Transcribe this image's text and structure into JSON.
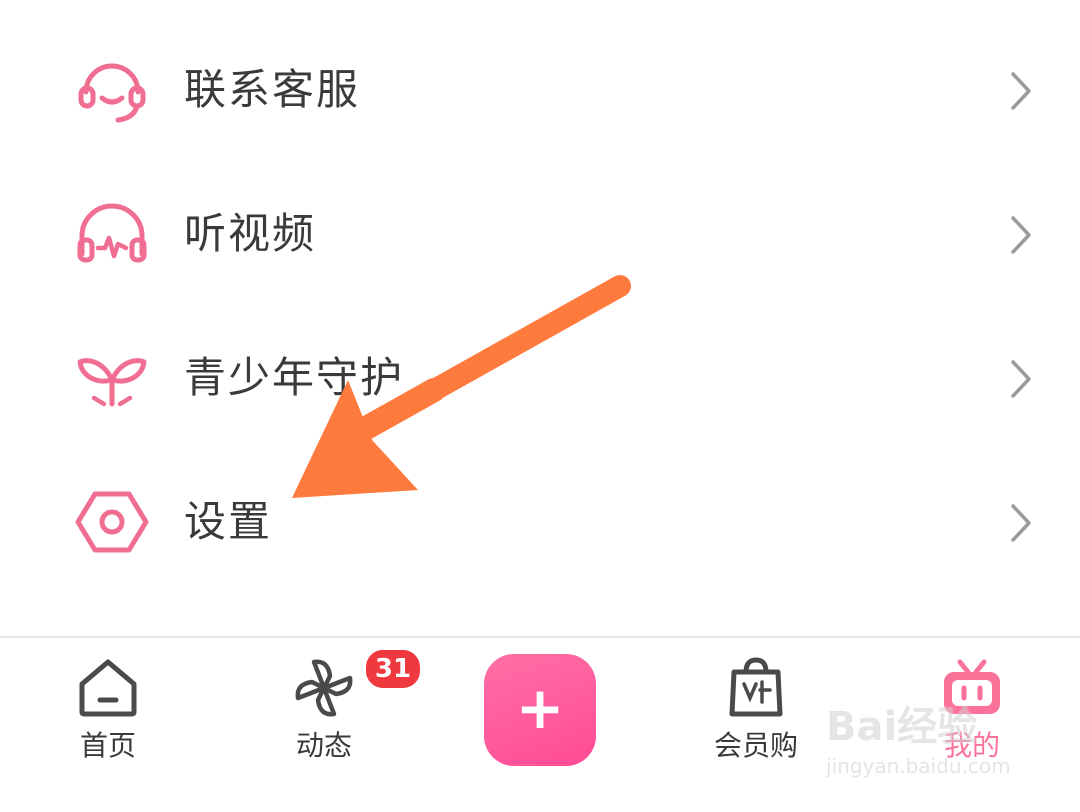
{
  "menu": {
    "items": [
      {
        "label": "联系客服",
        "icon": "headset-icon"
      },
      {
        "label": "听视频",
        "icon": "headphones-icon"
      },
      {
        "label": "青少年守护",
        "icon": "sprout-icon"
      },
      {
        "label": "设置",
        "icon": "hexagon-settings-icon"
      }
    ]
  },
  "tabbar": {
    "tabs": [
      {
        "label": "首页",
        "icon": "home-icon"
      },
      {
        "label": "动态",
        "icon": "pinwheel-icon",
        "badge": "31"
      },
      {
        "label": "",
        "icon": "plus-icon"
      },
      {
        "label": "会员购",
        "icon": "shopping-bag-icon"
      },
      {
        "label": "我的",
        "icon": "tv-icon",
        "active": true
      }
    ],
    "plus_glyph": "+"
  },
  "watermark": {
    "main": "Bai经验",
    "sub": "jingyan.baidu.com"
  },
  "colors": {
    "accent": "#fb7299",
    "icon_pink": "#f06e92",
    "arrow": "#ff7a3d",
    "badge": "#f0383f",
    "text": "#3a3a3a"
  }
}
